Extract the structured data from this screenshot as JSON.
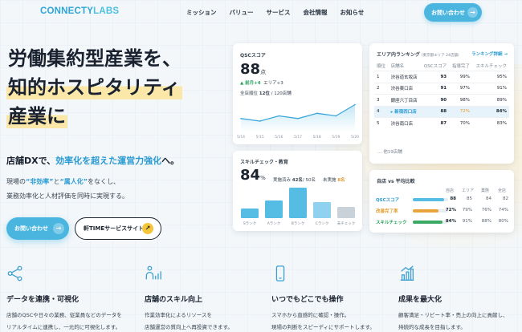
{
  "header": {
    "logo_part1": "CONNECTY",
    "logo_part2": "LABS",
    "nav": [
      "ミッション",
      "バリュー",
      "サービス",
      "会社情報",
      "お知らせ"
    ],
    "cta_label": "お問い合わせ",
    "cta_arrow": "→"
  },
  "hero": {
    "title_line1": "労働集約型産業を、",
    "title_line2": "知的ホスピタリティ",
    "title_line3": "産業に",
    "subtitle_prefix": "店舗DXで、",
    "subtitle_highlight": "効率化を超えた運営力強化",
    "subtitle_suffix": "へ。",
    "desc_1a": "現場の",
    "desc_1b": "“非効率”",
    "desc_1c": "と",
    "desc_1d": "“属人化”",
    "desc_1e": "をなくし、",
    "desc_2": "業務効率化と人材評価を同時に実現する。",
    "primary_button": "お問い合わせ",
    "secondary_button": "軒TIMEサービスサイト",
    "arrow": "→",
    "external_arrow": "↗"
  },
  "qsc_card": {
    "title": "QSCスコア",
    "score": "88",
    "score_unit": "点",
    "change": "▲ 前月+4",
    "area_change": "エリア+3",
    "overall_prefix": "全店順位",
    "overall_rank": "12位",
    "overall_suffix": "/ 120店舗"
  },
  "chart_data": {
    "type": "line",
    "title": "QSCスコア",
    "categories": [
      "5/14",
      "5/15",
      "5/16",
      "5/17",
      "5/18",
      "5/19",
      "5/20"
    ],
    "series": [
      {
        "values": [
          70,
          67,
          73,
          70,
          76,
          73,
          86
        ]
      }
    ],
    "ylim": [
      55,
      92
    ],
    "grid": false
  },
  "skill_card": {
    "title": "スキルチェック・教育",
    "score": "84",
    "unit": "%",
    "done_label": "実施済み",
    "done_value": "42名",
    "done_total": "/ 50名",
    "undone_label": "未実施",
    "undone_value": "8名",
    "bars": [
      {
        "label": "Sランク",
        "value": 12,
        "color": "#55bce4"
      },
      {
        "label": "Aランク",
        "value": 22,
        "color": "#55bce4"
      },
      {
        "label": "Bランク",
        "value": 38,
        "color": "#55bce4"
      },
      {
        "label": "Cランク",
        "value": 20,
        "color": "#8fd1ee"
      },
      {
        "label": "未チェック",
        "value": 14,
        "color": "#c9d1d9"
      }
    ]
  },
  "ranking": {
    "title": "エリア内ランキング",
    "subtitle": "(東京都エリア 24店舗)",
    "link": "ランキング詳細 →",
    "headers": [
      "順位",
      "店舗名",
      "QSCスコア",
      "指導完了",
      "スキルチェック"
    ],
    "rows": [
      {
        "rank": "1",
        "store": "渋谷道玄坂店",
        "qsc": "93",
        "guide": "99%",
        "skill": "95%"
      },
      {
        "rank": "2",
        "store": "渋谷東口店",
        "qsc": "91",
        "guide": "97%",
        "skill": "91%"
      },
      {
        "rank": "3",
        "store": "銀座六丁目店",
        "qsc": "90",
        "guide": "98%",
        "skill": "89%"
      },
      {
        "rank": "4",
        "store": "▸ 新宿西口店",
        "qsc": "88",
        "guide": "72%",
        "skill": "84%"
      },
      {
        "rank": "5",
        "store": "渋谷南口店",
        "qsc": "87",
        "guide": "70%",
        "skill": "83%"
      }
    ],
    "more": "… 他19店舗"
  },
  "compare": {
    "title": "自店 vs 平均比較",
    "headers": [
      "自店",
      "エリア",
      "業態",
      "全店"
    ],
    "rows": [
      {
        "label": "QSCスコア",
        "own": "88",
        "area": "85",
        "type": "84",
        "all": "82",
        "pct": 0.88,
        "color": "#55bce4",
        "label_color": "#2b9bd2"
      },
      {
        "label": "改善完了率",
        "own": "72%",
        "area": "79%",
        "type": "76%",
        "all": "74%",
        "pct": 0.72,
        "color": "#e8a33a",
        "label_color": "#e39a2c"
      },
      {
        "label": "スキルチェック",
        "own": "84%",
        "area": "91%",
        "type": "88%",
        "all": "80%",
        "pct": 0.84,
        "color": "#3aaa62",
        "label_color": "#27a35a"
      }
    ]
  },
  "features": [
    {
      "icon": "share-nodes-icon",
      "title": "データを連携・可視化",
      "line1": "店舗のQSCや日々の業務、従業員などのデータを",
      "line2": "リアルタイムに連携し、一元的に可視化します。"
    },
    {
      "icon": "person-chart-icon",
      "title": "店舗のスキル向上",
      "line1": "作業効率化によるリソースを",
      "line2": "店舗運営の質向上へ再投資できます。"
    },
    {
      "icon": "smartphone-icon",
      "title": "いつでもどこでも操作",
      "line1": "スマホから直感的に確認・操作。",
      "line2": "現場の判断をスピーディにサポートします。"
    },
    {
      "icon": "growth-chart-icon",
      "title": "成果を最大化",
      "line1": "顧客満足・リピート率・売上の向上に貢献し、",
      "line2": "持続的な成長を目指します。"
    }
  ]
}
